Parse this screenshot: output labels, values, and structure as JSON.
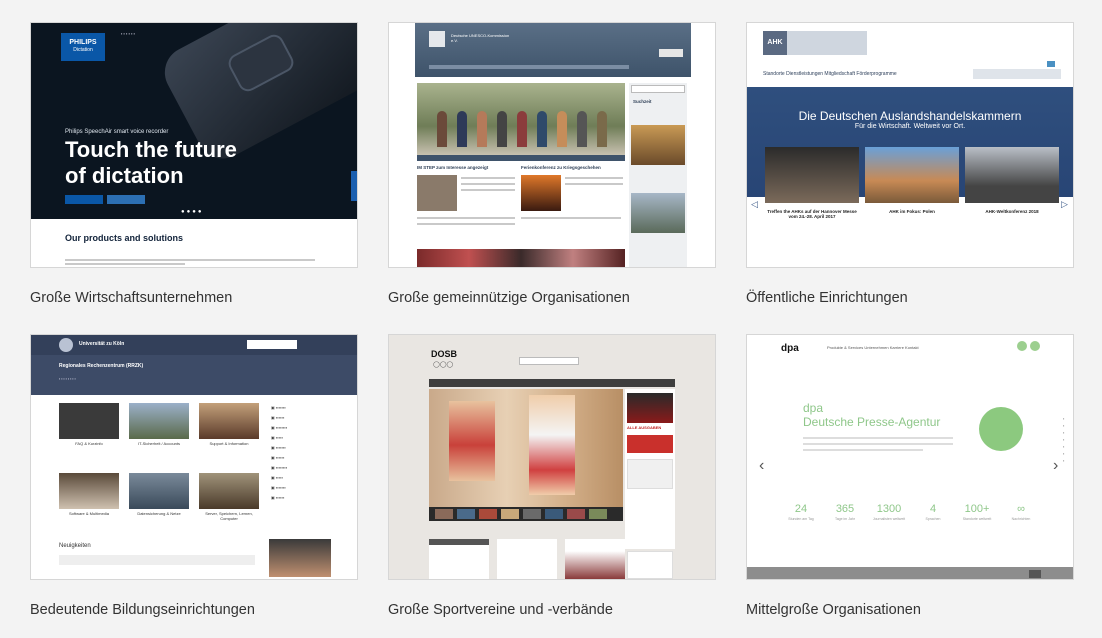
{
  "cards": [
    {
      "caption": "Große Wirtschaftsunternehmen",
      "screen": {
        "logo": "PHILIPS",
        "logo_sub": "Dictation",
        "kicker": "Philips SpeechAir smart voice recorder",
        "headline_line1": "Touch the future",
        "headline_line2": "of dictation",
        "section_heading": "Our products and solutions"
      }
    },
    {
      "caption": "Große gemeinnützige Organisationen",
      "screen": {
        "logo_text": "Deutsche UNESCO-Kommission e.V.",
        "news_left": "IM STEP zum Interesse angezeigt",
        "news_right": "Ferienkonferenz zu Kriegsgeschehen",
        "sidebar_head": "Suchzeit"
      }
    },
    {
      "caption": "Öffentliche Einrichtungen",
      "screen": {
        "logo": "AHK",
        "nav": "Standorte   Dienstleistungen   Mitgliedschaft   Förderprogramme",
        "banner_title": "Die Deutschen Auslandshandelskammern",
        "banner_sub": "Für die Wirtschaft. Weltweit vor Ort.",
        "items": [
          "Treffen the AHKs auf der Hannover Messe vom 24.-28. April 2017",
          "AHK im Fokus: Polen",
          "AHK-Weltkonferenz 2018"
        ]
      }
    },
    {
      "caption": "Bedeutende Bildungseinrichtungen",
      "screen": {
        "header": "Universität zu Köln",
        "subheader": "Regionales Rechenzentrum (RRZK)",
        "tiles": [
          "FAQ & Kurzinfo",
          "IT-Sicherheit / Accounts",
          "Support & Information",
          "Software & Multimedia",
          "Datensicherung & Netze",
          "Server, Speichern, Lernen, Computer"
        ],
        "section": "Neuigkeiten"
      }
    },
    {
      "caption": "Große Sportvereine und -verbände",
      "screen": {
        "logo": "DOSB",
        "side_label": "ALLE AUSGABEN"
      }
    },
    {
      "caption": "Mittelgroße Organisationen",
      "screen": {
        "logo": "dpa",
        "nav": "Produkte & Services   Unternehmen   Karriere   Kontakt",
        "headline_line1": "dpa",
        "headline_line2": "Deutsche Presse-Agentur",
        "stats": [
          {
            "value": "24",
            "label": "Stunden am Tag"
          },
          {
            "value": "365",
            "label": "Tage im Jahr"
          },
          {
            "value": "1300",
            "label": "Journalisten weltweit"
          },
          {
            "value": "4",
            "label": "Sprachen"
          },
          {
            "value": "100+",
            "label": "Standorte weltweit"
          },
          {
            "value": "∞",
            "label": "Nachrichten"
          }
        ]
      }
    }
  ]
}
